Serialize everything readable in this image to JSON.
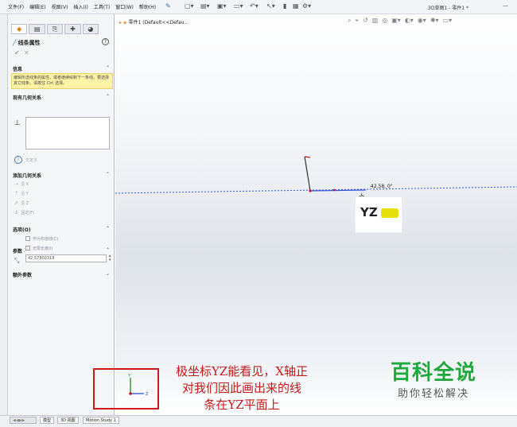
{
  "menu": {
    "items": [
      "文件(F)",
      "编辑(E)",
      "视图(V)",
      "插入(I)",
      "工具(T)",
      "窗口(W)",
      "帮助(H)"
    ]
  },
  "window": {
    "title": "3D草图1 - 零件1 *"
  },
  "property_manager": {
    "title": "线条属性",
    "info_header": "信息",
    "info_message": "编辑所选线条的属性，或者继续绘制下一条线。要选择其它线条，请按住 Ctrl 选择。",
    "existing_relations_header": "现有几何关系",
    "delete_relations_label": "欠定义",
    "add_relations_header": "添加几何关系",
    "add_relations": [
      "沿 X",
      "沿 Y",
      "沿 Z",
      "固定(F)"
    ],
    "options_header": "选项(O)",
    "option_construction": "作为构造线(C)",
    "option_infinite": "无限长度(I)",
    "parameters_header": "参数",
    "length_value": "42.57800318",
    "extra_params_header": "额外参数"
  },
  "feature_tree": {
    "node_label": "零件1 (Default<<Defau..."
  },
  "graphics": {
    "dimension_label": "42.58, 0°",
    "inference_label": "YZ"
  },
  "bottom_tabs": [
    "模型",
    "3D 视图",
    "Motion Study 1"
  ],
  "annotation": {
    "callout_lines": [
      "极坐标YZ能看见，X轴正",
      "对我们因此画出来的线",
      "条在YZ平面上"
    ]
  },
  "watermark": {
    "title": "百科全说",
    "subtitle": "助你轻松解决"
  },
  "colors": {
    "callout_red": "#c81818",
    "watermark_green": "#1fa83b",
    "axis_green": "#1a8c1a",
    "axis_blue": "#1f4fd8",
    "axis_red": "#d01818"
  }
}
